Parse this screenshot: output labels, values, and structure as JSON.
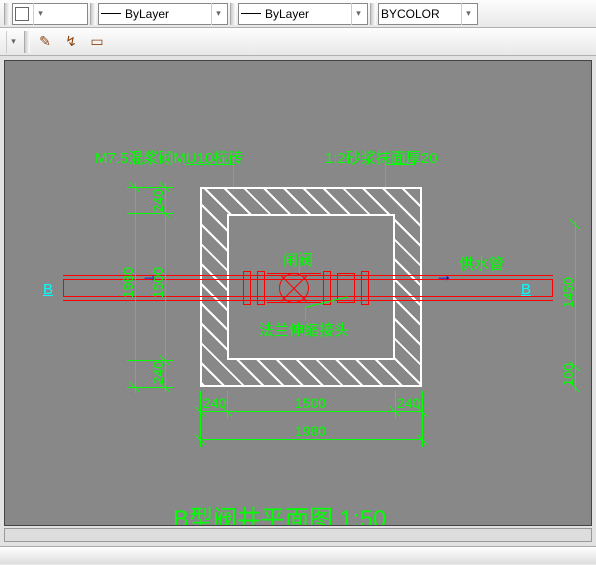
{
  "toolbar": {
    "color_swatch": "#ffffff",
    "line_label_1": "ByLayer",
    "line_label_2": "ByLayer",
    "color_label": "BYCOLOR"
  },
  "drawing": {
    "annotation_left": "M7.5混浆砌MU10标砖",
    "annotation_right": "1:2砂浆抹面厚20",
    "valve_label": "闸阀",
    "supply_label": "供水管",
    "flange_label": "法兰伸缩接头",
    "section_marker": "B",
    "title": "B型阀井平面图 1:50",
    "dims": {
      "outer_w": "1980",
      "outer_h": "1980",
      "inner_w": "1500",
      "inner_h": "1500",
      "wall": "240",
      "right_h": "1450",
      "right_off": "100"
    }
  }
}
